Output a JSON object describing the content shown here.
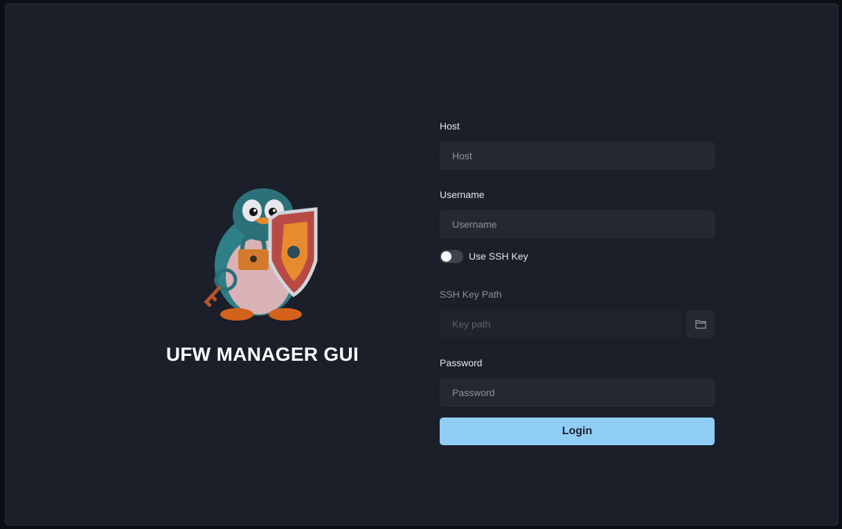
{
  "app": {
    "title": "UFW MANAGER GUI",
    "logo": "penguin-shield-logo"
  },
  "form": {
    "host": {
      "label": "Host",
      "placeholder": "Host",
      "value": ""
    },
    "username": {
      "label": "Username",
      "placeholder": "Username",
      "value": ""
    },
    "ssh_toggle": {
      "label": "Use SSH Key",
      "enabled": false
    },
    "ssh_key_path": {
      "label": "SSH Key Path",
      "placeholder": "Key path",
      "value": "",
      "browse_icon": "folder-icon"
    },
    "password": {
      "label": "Password",
      "placeholder": "Password",
      "value": ""
    },
    "login_label": "Login"
  },
  "colors": {
    "background": "#1a1f29",
    "input_bg": "#232833",
    "accent": "#90cdf4",
    "text": "#e6e8ec"
  }
}
